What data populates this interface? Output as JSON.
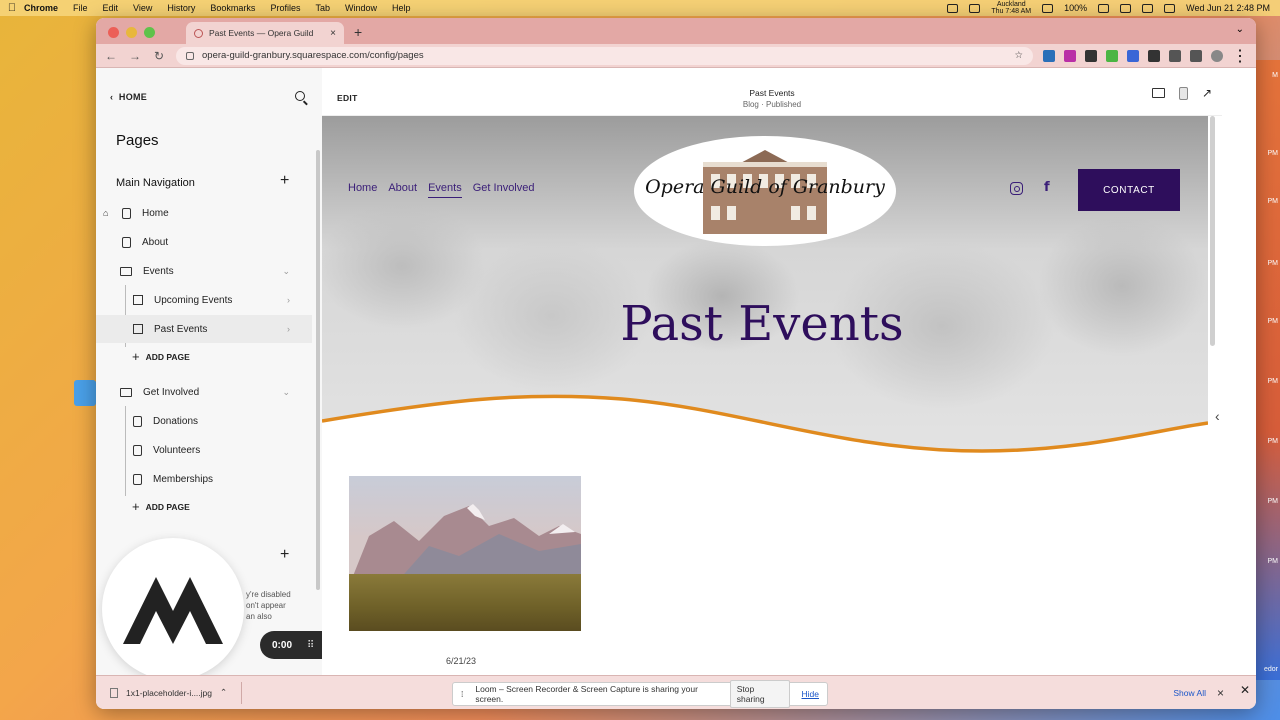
{
  "menubar": {
    "app": "Chrome",
    "items": [
      "File",
      "Edit",
      "View",
      "History",
      "Bookmarks",
      "Profiles",
      "Tab",
      "Window",
      "Help"
    ],
    "timezone_city": "Auckland",
    "timezone_time": "Thu 7:48 AM",
    "battery": "100%",
    "datetime": "Wed Jun 21  2:48 PM"
  },
  "desktop": {
    "right_labels": [
      "M",
      "PM",
      "PM",
      "PM",
      "PM",
      "PM",
      "PM",
      "PM",
      "PM",
      "edor"
    ]
  },
  "browser": {
    "tab_title": "Past Events — Opera Guild",
    "new_tab": "+",
    "url": "opera-guild-granbury.squarespace.com/config/pages"
  },
  "sidebar": {
    "back_label": "HOME",
    "title": "Pages",
    "main_navigation": "Main Navigation",
    "items": [
      {
        "label": "Home",
        "type": "page"
      },
      {
        "label": "About",
        "type": "page"
      },
      {
        "label": "Events",
        "type": "folder"
      },
      {
        "label": "Upcoming Events",
        "type": "blog"
      },
      {
        "label": "Past Events",
        "type": "blog"
      },
      {
        "label": "Get Involved",
        "type": "folder"
      },
      {
        "label": "Donations",
        "type": "page"
      },
      {
        "label": "Volunteers",
        "type": "page"
      },
      {
        "label": "Memberships",
        "type": "page"
      }
    ],
    "add_page": "ADD PAGE",
    "disabled_note": "y're disabled\non't appear\nan also"
  },
  "loom": {
    "timer": "0:00"
  },
  "editor": {
    "edit_label": "EDIT",
    "page_title": "Past Events",
    "page_status": "Blog · Published"
  },
  "site": {
    "nav": [
      "Home",
      "About",
      "Events",
      "Get Involved"
    ],
    "active_nav": "Events",
    "logo_text": "Opera Guild of Granbury",
    "contact_label": "CONTACT",
    "hero_title": "Past Events",
    "post_date": "6/21/23",
    "accent_color": "#2e0e5c",
    "wave_color": "#e08a1e"
  },
  "shelf": {
    "download_name": "1x1-placeholder-i....jpg",
    "share_text": "Loom – Screen Recorder & Screen Capture is sharing your screen.",
    "stop_sharing": "Stop sharing",
    "hide": "Hide",
    "show_all": "Show All"
  }
}
